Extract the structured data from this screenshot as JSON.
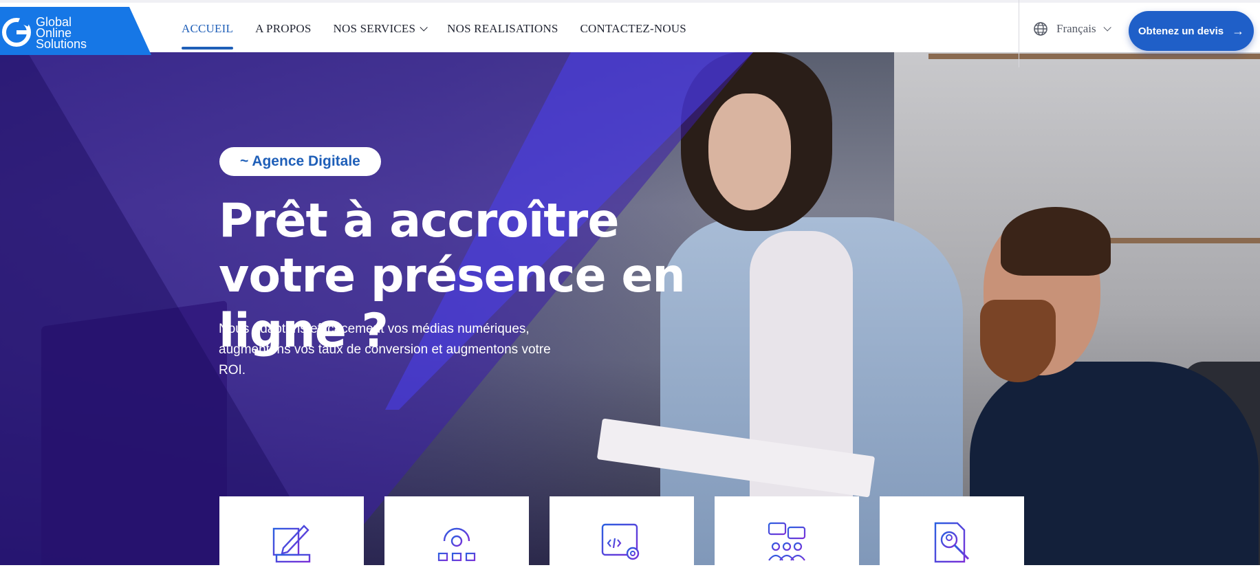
{
  "header": {
    "logo": {
      "lines": [
        "Global",
        "Online",
        "Solutions"
      ]
    },
    "nav": [
      {
        "label": "ACCUEIL",
        "active": true
      },
      {
        "label": "A PROPOS"
      },
      {
        "label": "NOS SERVICES",
        "has_dropdown": true
      },
      {
        "label": "NOS REALISATIONS"
      },
      {
        "label": "CONTACTEZ-NOUS"
      }
    ],
    "language": {
      "selected": "Français",
      "icon": "globe-icon"
    },
    "cta": {
      "label": "Obtenez un devis",
      "icon": "arrow-right-icon"
    }
  },
  "hero": {
    "badge": "~ Agence Digitale",
    "title": "Prêt à accroître votre présence en ligne ?",
    "description": "Nous adaptons efficacement vos médias numériques, augmentons vos taux de conversion et augmentons votre ROI."
  },
  "service_cards": [
    {
      "icon": "design-pencil-ruler-icon"
    },
    {
      "icon": "network-gear-icon"
    },
    {
      "icon": "web-code-settings-icon"
    },
    {
      "icon": "team-chat-icon"
    },
    {
      "icon": "document-search-icon"
    }
  ],
  "colors": {
    "brand_blue": "#1677e6",
    "nav_active": "#1f5fb8",
    "cta": "#1f5fc8",
    "overlay_purple": "#3a1ea8"
  }
}
